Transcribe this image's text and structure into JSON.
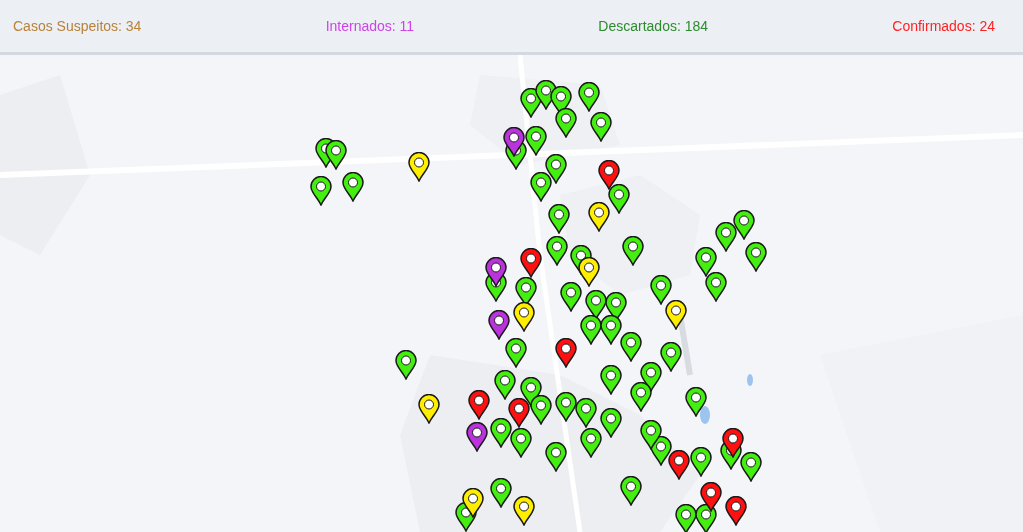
{
  "stats": [
    {
      "label": "Casos Suspeitos: 34",
      "color": "#b8823a"
    },
    {
      "label": "Internados: 11",
      "color": "#cc44e6"
    },
    {
      "label": "Descartados: 184",
      "color": "#2e8b2e"
    },
    {
      "label": "Confirmados: 24",
      "color": "#ff2222"
    }
  ],
  "markers": [
    {
      "color": "#44ee11"
    },
    {
      "color": "#44ee11"
    },
    {
      "color": "#44ee11"
    },
    {
      "color": "#44ee11"
    },
    {
      "color": "#44ee11"
    },
    {
      "color": "#44ee11"
    },
    {
      "color": "#44ee11"
    },
    {
      "color": "#44ee11"
    },
    {
      "color": "#44ee11"
    },
    {
      "color": "#44ee11"
    },
    {
      "color": "#44ee11"
    },
    {
      "color": "#44ee11"
    },
    {
      "color": "#44ee11"
    },
    {
      "color": "#44ee11"
    },
    {
      "color": "#44ee11"
    },
    {
      "color": "#44ee11"
    },
    {
      "color": "#44ee11"
    },
    {
      "color": "#44ee11"
    },
    {
      "color": "#44ee11"
    },
    {
      "color": "#44ee11"
    },
    {
      "color": "#44ee11"
    },
    {
      "color": "#44ee11"
    },
    {
      "color": "#44ee11"
    },
    {
      "color": "#44ee11"
    },
    {
      "color": "#44ee11"
    },
    {
      "color": "#44ee11"
    },
    {
      "color": "#44ee11"
    },
    {
      "color": "#44ee11"
    },
    {
      "color": "#44ee11"
    },
    {
      "color": "#44ee11"
    },
    {
      "color": "#44ee11"
    },
    {
      "color": "#44ee11"
    },
    {
      "color": "#44ee11"
    },
    {
      "color": "#44ee11"
    },
    {
      "color": "#44ee11"
    },
    {
      "color": "#44ee11"
    },
    {
      "color": "#44ee11"
    },
    {
      "color": "#44ee11"
    },
    {
      "color": "#44ee11"
    },
    {
      "color": "#44ee11"
    },
    {
      "color": "#44ee11"
    },
    {
      "color": "#44ee11"
    },
    {
      "color": "#44ee11"
    },
    {
      "color": "#44ee11"
    },
    {
      "color": "#44ee11"
    },
    {
      "color": "#44ee11"
    },
    {
      "color": "#44ee11"
    },
    {
      "color": "#44ee11"
    },
    {
      "color": "#44ee11"
    },
    {
      "color": "#44ee11"
    },
    {
      "color": "#44ee11"
    },
    {
      "color": "#44ee11"
    },
    {
      "color": "#44ee11"
    },
    {
      "color": "#44ee11"
    },
    {
      "color": "#44ee11"
    },
    {
      "color": "#44ee11"
    },
    {
      "color": "#44ee11"
    },
    {
      "color": "#44ee11"
    },
    {
      "color": "#44ee11"
    },
    {
      "color": "#44ee11"
    },
    {
      "color": "#ffee00"
    },
    {
      "color": "#ffee00"
    },
    {
      "color": "#ffee00"
    },
    {
      "color": "#ffee00"
    },
    {
      "color": "#ffee00"
    },
    {
      "color": "#ffee00"
    },
    {
      "color": "#ffee00"
    },
    {
      "color": "#ffee00"
    },
    {
      "color": "#ff1111"
    },
    {
      "color": "#ff1111"
    },
    {
      "color": "#ff1111"
    },
    {
      "color": "#ff1111"
    },
    {
      "color": "#ff1111"
    },
    {
      "color": "#ff1111"
    },
    {
      "color": "#ff1111"
    },
    {
      "color": "#ff1111"
    },
    {
      "color": "#ff1111"
    },
    {
      "color": "#bb33dd"
    },
    {
      "color": "#bb33dd"
    },
    {
      "color": "#bb33dd"
    },
    {
      "color": "#bb33dd"
    }
  ]
}
